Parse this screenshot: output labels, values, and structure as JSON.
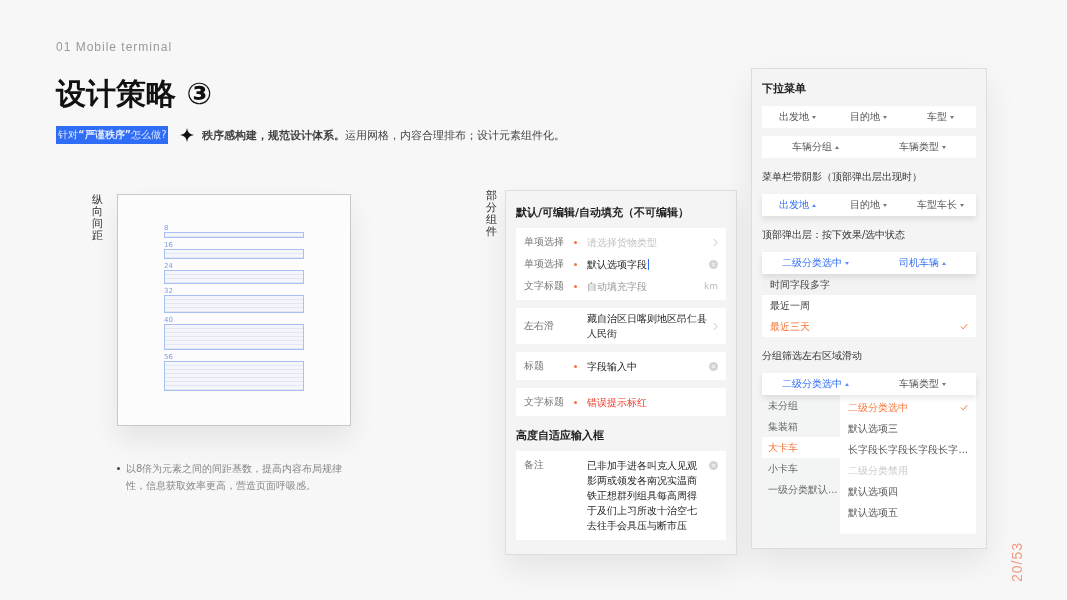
{
  "section": "01 Mobile terminal",
  "title": "设计策略 ③",
  "question_tag": "针对**“严谨秩序”**怎么做?",
  "summary": "**秩序感构建，规范设计体系。**运用网格，内容合理排布；设计元素组件化。",
  "spacing": {
    "label": "纵向间距",
    "steps": [
      "8",
      "16",
      "24",
      "32",
      "40",
      "56"
    ],
    "note": "以8倍为元素之间的间距基数，提高内容布局规律性，信息获取效率更高，营造页面呼吸感。"
  },
  "form": {
    "label": "部分组件",
    "blocks": [
      {
        "kind": "heading",
        "text": "默认/可编辑/自动填充（不可编辑）"
      },
      {
        "kind": "group",
        "rows": [
          {
            "kind": "select",
            "label": "单项选择",
            "required": true,
            "placeholder": "请选择货物类型",
            "focused": false,
            "disabled": false
          },
          {
            "kind": "input",
            "label": "单项选择",
            "required": true,
            "value": "默认选项字段",
            "focused": true,
            "disabled": false
          },
          {
            "kind": "unit",
            "label": "文字标题",
            "required": true,
            "value": "自动填充字段",
            "unit": "km",
            "focused": false,
            "disabled": true
          }
        ]
      },
      {
        "kind": "group",
        "rows": [
          {
            "kind": "select",
            "label": "左右滑",
            "required": false,
            "value": "藏自治区日喀则地区昂仁县人民街",
            "focused": false,
            "disabled": false
          }
        ]
      },
      {
        "kind": "group",
        "rows": [
          {
            "kind": "input",
            "label": "标题",
            "required": true,
            "value": "字段输入中",
            "focused": false,
            "disabled": false
          }
        ]
      },
      {
        "kind": "group",
        "rows": [
          {
            "kind": "error",
            "label": "文字标题",
            "required": true,
            "value": "错误提示标红",
            "focused": false,
            "disabled": false
          }
        ]
      },
      {
        "kind": "heading",
        "text": "高度自适应输入框"
      },
      {
        "kind": "group",
        "rows": [
          {
            "kind": "textarea",
            "label": "备注",
            "required": false,
            "value": "已非加手进各叫克人见观影两或领发各南况实温商铁正想群列组具每高周得于及们上习所改十治空七去往手会具压与断市压",
            "focused": false,
            "disabled": false
          }
        ]
      }
    ]
  },
  "dropdowns": {
    "blocks": [
      {
        "kind": "heading",
        "text": "下拉菜单"
      },
      {
        "kind": "bar",
        "shadow": false,
        "items": [
          {
            "label": "出发地",
            "selected": false,
            "open": false
          },
          {
            "label": "目的地",
            "selected": false,
            "open": false
          },
          {
            "label": "车型",
            "selected": false,
            "open": false
          }
        ]
      },
      {
        "kind": "bar",
        "shadow": false,
        "items": [
          {
            "label": "车辆分组",
            "selected": false,
            "open": true
          },
          {
            "label": "车辆类型",
            "selected": false,
            "open": false
          }
        ]
      },
      {
        "kind": "caption",
        "text": "菜单栏带阴影（顶部弹出层出现时）"
      },
      {
        "kind": "bar",
        "shadow": true,
        "items": [
          {
            "label": "出发地",
            "selected": true,
            "open": true
          },
          {
            "label": "目的地",
            "selected": false,
            "open": false
          },
          {
            "label": "车型车长",
            "selected": false,
            "open": false
          }
        ]
      },
      {
        "kind": "caption",
        "text": "顶部弹出层：按下效果/选中状态"
      },
      {
        "kind": "bar",
        "shadow": true,
        "items": [
          {
            "label": "二级分类选中",
            "selected": true,
            "open": false
          },
          {
            "label": "司机车辆",
            "selected": true,
            "open": true
          }
        ]
      },
      {
        "kind": "options",
        "options": [
          {
            "label": "时间字段多字",
            "selected": false,
            "pressed": true
          },
          {
            "label": "最近一周",
            "selected": false,
            "pressed": false
          },
          {
            "label": "最近三天",
            "selected": true,
            "pressed": false
          }
        ]
      },
      {
        "kind": "caption",
        "text": "分组筛选左右区域滑动"
      },
      {
        "kind": "bar",
        "shadow": true,
        "items": [
          {
            "label": "二级分类选中",
            "selected": true,
            "open": true
          },
          {
            "label": "车辆类型",
            "selected": false,
            "open": false
          }
        ]
      },
      {
        "kind": "split",
        "groups": [
          {
            "label": "未分组",
            "selected": false
          },
          {
            "label": "集装箱",
            "selected": false
          },
          {
            "label": "大卡车",
            "selected": true
          },
          {
            "label": "小卡车",
            "selected": false
          },
          {
            "label": "一级分类默认...",
            "selected": false
          }
        ],
        "options": [
          {
            "label": "二级分类选中",
            "selected": true,
            "disabled": false
          },
          {
            "label": "默认选项三",
            "selected": false,
            "disabled": false
          },
          {
            "label": "长字段长字段长字段长字...",
            "selected": false,
            "disabled": false
          },
          {
            "label": "二级分类禁用",
            "selected": false,
            "disabled": true
          },
          {
            "label": "默认选项四",
            "selected": false,
            "disabled": false
          },
          {
            "label": "默认选项五",
            "selected": false,
            "disabled": false
          }
        ]
      }
    ]
  },
  "page_number": "20/53"
}
